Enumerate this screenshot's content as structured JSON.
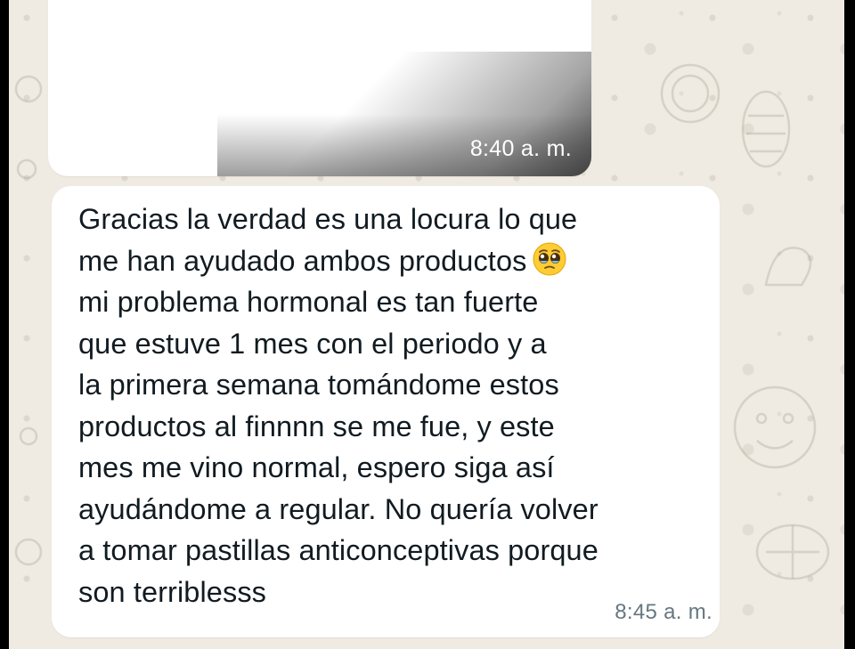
{
  "chat": {
    "background_color": "#efeae2",
    "bubble_color": "#ffffff",
    "messages": [
      {
        "type": "media",
        "time": "8:40 a. m."
      },
      {
        "type": "text",
        "lines": [
          "Gracias la verdad es una locura lo que",
          "me han ayudado ambos productos",
          "mi problema hormonal es tan fuerte",
          "que estuve 1 mes con el periodo y a",
          "la primera semana tomándome estos",
          "productos al finnnn se me fue, y este",
          "mes me vino normal, espero siga así",
          "ayudándome a regular. No quería volver",
          "a tomar pastillas anticonceptivas porque",
          "son terriblesss"
        ],
        "emoji": "pleading-face-emoji",
        "time": "8:45 a. m."
      }
    ]
  }
}
